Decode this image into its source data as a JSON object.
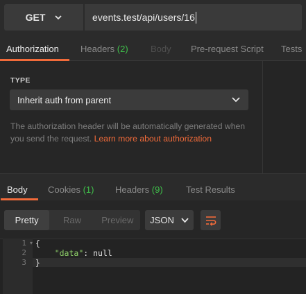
{
  "request": {
    "method": "GET",
    "url": "events.test/api/users/16"
  },
  "request_tabs": [
    {
      "label": "Authorization",
      "count": ""
    },
    {
      "label": "Headers",
      "count": "(2)"
    },
    {
      "label": "Body",
      "count": ""
    },
    {
      "label": "Pre-request Script",
      "count": ""
    },
    {
      "label": "Tests",
      "count": ""
    }
  ],
  "auth": {
    "type_label": "TYPE",
    "type_value": "Inherit auth from parent",
    "description": "The authorization header will be automatically generated when you send the request.",
    "learn_more": "Learn more about authorization"
  },
  "response_tabs": [
    {
      "label": "Body",
      "count": ""
    },
    {
      "label": "Cookies",
      "count": "(1)"
    },
    {
      "label": "Headers",
      "count": "(9)"
    },
    {
      "label": "Test Results",
      "count": ""
    }
  ],
  "view_modes": [
    "Pretty",
    "Raw",
    "Preview"
  ],
  "format": "JSON",
  "code_lines": [
    {
      "num": "1",
      "text": "{"
    },
    {
      "num": "2",
      "key": "\"data\"",
      "rest": ": null"
    },
    {
      "num": "3",
      "text": "}"
    }
  ],
  "colors": {
    "accent": "#f26b3a",
    "count_green": "#3fbf4a",
    "json_key": "#8fd16a"
  },
  "icons": [
    "chevron-down-icon",
    "wrap-lines-icon",
    "fold-arrow-icon"
  ]
}
